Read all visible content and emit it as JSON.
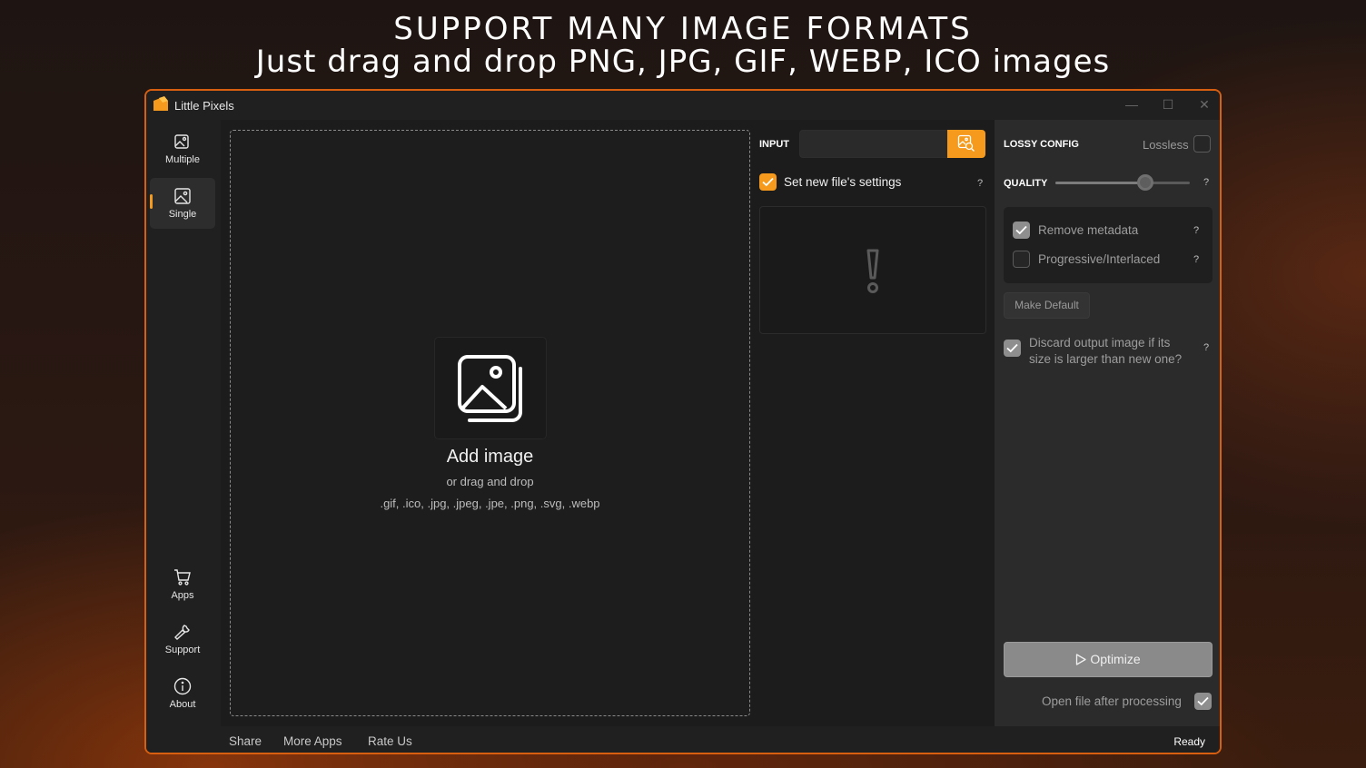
{
  "banner": {
    "headline": "SUPPORT MANY IMAGE FORMATS",
    "subheadline": "Just drag and drop PNG, JPG, GIF, WEBP, ICO images"
  },
  "window": {
    "title": "Little Pixels",
    "controls": {
      "minimize": "—",
      "maximize": "☐",
      "close": "✕"
    }
  },
  "sidebar": {
    "top": [
      {
        "label": "Multiple",
        "icon": "images-icon",
        "active": false
      },
      {
        "label": "Single",
        "icon": "image-icon",
        "active": true
      }
    ],
    "bottom": [
      {
        "label": "Apps",
        "icon": "cart-icon"
      },
      {
        "label": "Support",
        "icon": "wrench-icon"
      },
      {
        "label": "About",
        "icon": "info-icon"
      }
    ]
  },
  "dropzone": {
    "title": "Add image",
    "subtitle": "or drag and drop",
    "formats": ".gif, .ico, .jpg, .jpeg, .jpe, .png, .svg, .webp",
    "icon": "image-stack-icon"
  },
  "input": {
    "label": "INPUT",
    "value": "",
    "button_icon": "browse-images-icon",
    "set_new_settings": {
      "label": "Set new file's settings",
      "checked": true
    },
    "help": "?",
    "preview_icon": "exclamation-icon"
  },
  "config": {
    "title": "LOSSY CONFIG",
    "lossless": {
      "label": "Lossless",
      "checked": false
    },
    "quality": {
      "label": "QUALITY",
      "value_fraction": 0.67
    },
    "help": "?",
    "options": [
      {
        "label": "Remove metadata",
        "checked": true
      },
      {
        "label": "Progressive/Interlaced",
        "checked": false
      }
    ],
    "make_default": "Make Default",
    "discard": {
      "label": "Discard output image if its size is larger than new one?",
      "checked": true
    },
    "optimize": "Optimize",
    "open_after": {
      "label": "Open file after processing",
      "checked": true
    }
  },
  "statusbar": {
    "links": [
      "Share",
      "More Apps",
      "Rate Us"
    ],
    "status": "Ready"
  },
  "colors": {
    "accent": "#f59a1c",
    "window_border": "#d95f10"
  }
}
